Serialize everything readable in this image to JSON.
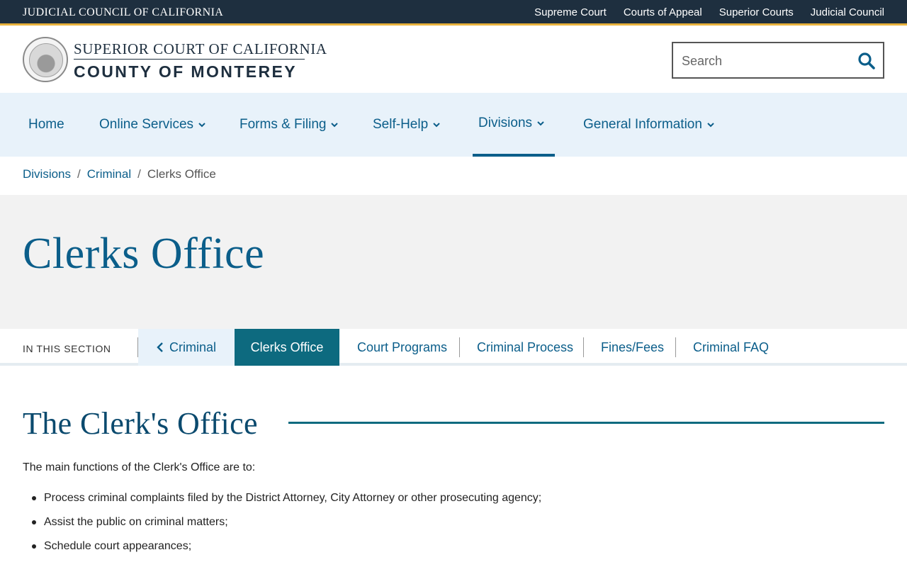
{
  "topbar": {
    "title": "JUDICIAL COUNCIL OF CALIFORNIA",
    "links": [
      "Supreme Court",
      "Courts of Appeal",
      "Superior Courts",
      "Judicial Council"
    ]
  },
  "header": {
    "line1": "SUPERIOR COURT OF CALIFORNIA",
    "line2": "COUNTY OF MONTEREY",
    "search_placeholder": "Search",
    "search_icon": "search-icon"
  },
  "nav": {
    "items": [
      {
        "label": "Home",
        "dropdown": false
      },
      {
        "label": "Online Services",
        "dropdown": true
      },
      {
        "label": "Forms & Filing",
        "dropdown": true
      },
      {
        "label": "Self-Help",
        "dropdown": true
      },
      {
        "label": "Divisions",
        "dropdown": true,
        "active": true
      },
      {
        "label": "General Information",
        "dropdown": true
      }
    ]
  },
  "breadcrumb": {
    "links": [
      "Divisions",
      "Criminal"
    ],
    "separator": "/",
    "current": "Clerks Office"
  },
  "hero": {
    "title": "Clerks Office"
  },
  "section_nav": {
    "label": "IN THIS SECTION",
    "back": "Criminal",
    "current": "Clerks Office",
    "tabs": [
      "Court Programs",
      "Criminal Process",
      "Fines/Fees",
      "Criminal FAQ"
    ]
  },
  "content": {
    "title": "The Clerk's Office",
    "intro": "The main functions of the Clerk's Office are to:",
    "list": [
      "Process criminal complaints filed by the District Attorney, City Attorney or other prosecuting agency;",
      "Assist the public on criminal matters;",
      "Schedule court appearances;"
    ]
  },
  "colors": {
    "topbar_bg": "#1e2f3f",
    "accent_gold": "#e8b23c",
    "link_blue": "#0b5e8a",
    "teal": "#0d6a7f",
    "nav_bg": "#e8f2fa",
    "hero_bg": "#f2f2f2"
  }
}
